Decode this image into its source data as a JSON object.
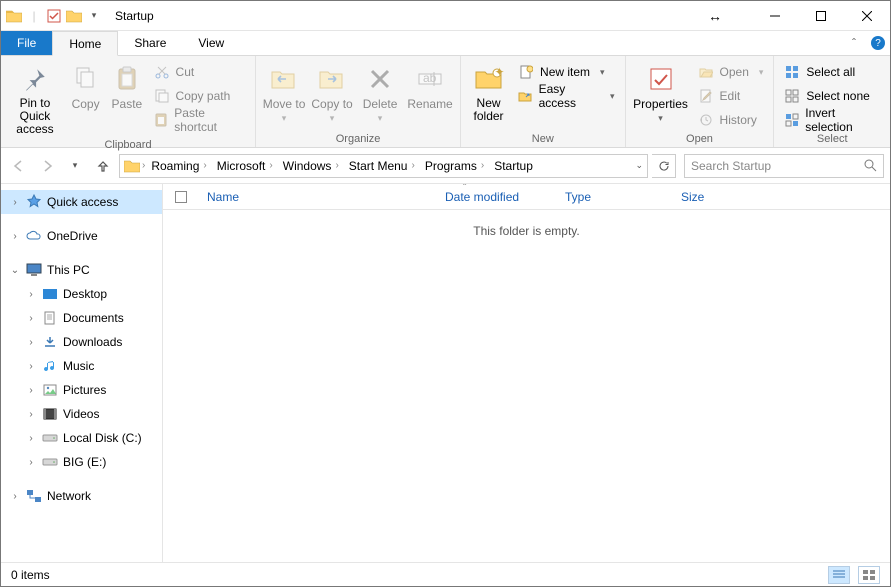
{
  "window": {
    "title": "Startup"
  },
  "tabs": {
    "file": "File",
    "home": "Home",
    "share": "Share",
    "view": "View"
  },
  "ribbon": {
    "pin": "Pin to Quick access",
    "copy": "Copy",
    "paste": "Paste",
    "cut": "Cut",
    "copypath": "Copy path",
    "pasteshortcut": "Paste shortcut",
    "clipboard": "Clipboard",
    "moveto": "Move to",
    "copyto": "Copy to",
    "delete": "Delete",
    "rename": "Rename",
    "organize": "Organize",
    "newfolder": "New folder",
    "newitem": "New item",
    "easyaccess": "Easy access",
    "new": "New",
    "properties": "Properties",
    "open": "Open",
    "edit": "Edit",
    "history": "History",
    "open_group": "Open",
    "selectall": "Select all",
    "selectnone": "Select none",
    "invert": "Invert selection",
    "select": "Select"
  },
  "breadcrumb": [
    "Roaming",
    "Microsoft",
    "Windows",
    "Start Menu",
    "Programs",
    "Startup"
  ],
  "search": {
    "placeholder": "Search Startup"
  },
  "nav": {
    "quick": "Quick access",
    "onedrive": "OneDrive",
    "thispc": "This PC",
    "desktop": "Desktop",
    "documents": "Documents",
    "downloads": "Downloads",
    "music": "Music",
    "pictures": "Pictures",
    "videos": "Videos",
    "localc": "Local Disk (C:)",
    "bige": "BIG (E:)",
    "network": "Network"
  },
  "columns": {
    "name": "Name",
    "date": "Date modified",
    "type": "Type",
    "size": "Size"
  },
  "content": {
    "empty": "This folder is empty."
  },
  "status": {
    "items": "0 items"
  }
}
